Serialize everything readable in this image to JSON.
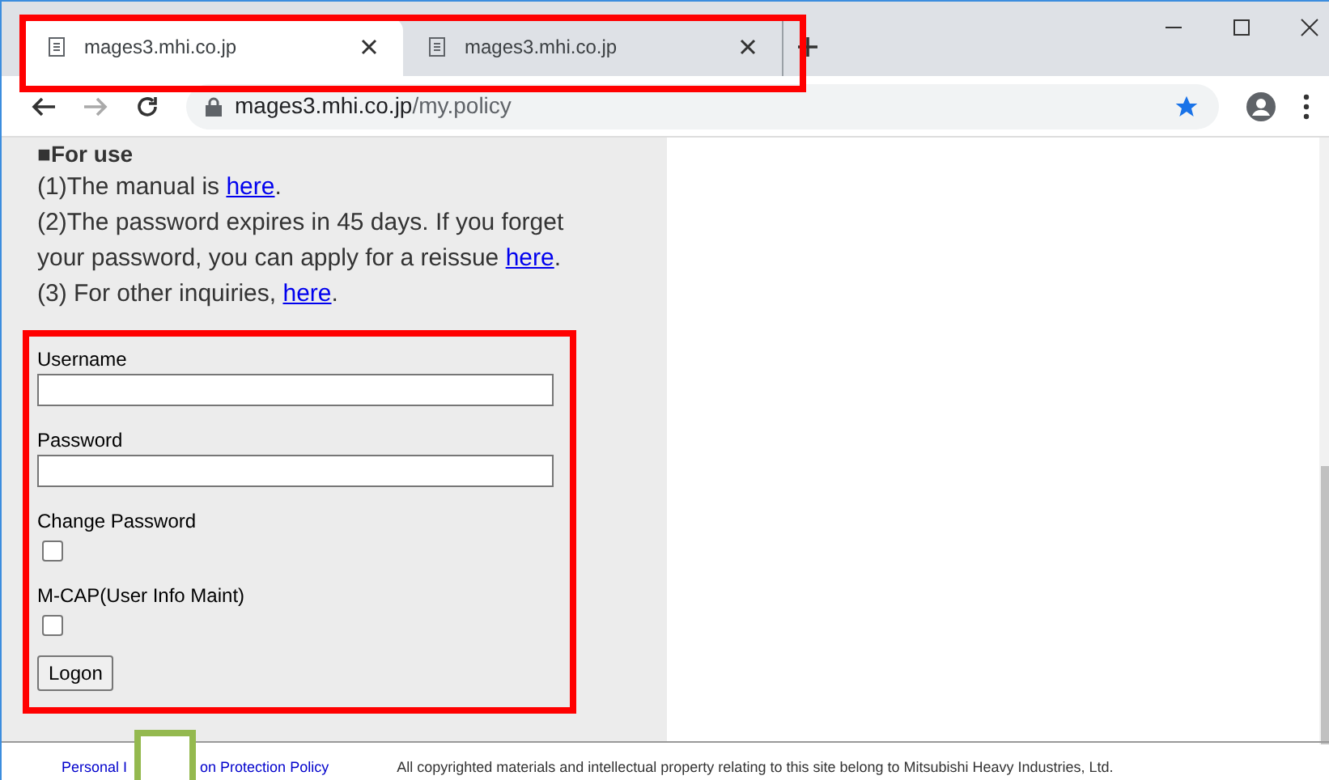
{
  "tabs": [
    {
      "title": "mages3.mhi.co.jp",
      "selected": true
    },
    {
      "title": "mages3.mhi.co.jp",
      "selected": false
    }
  ],
  "address_bar": {
    "domain": "mages3.mhi.co.jp",
    "path": "/my.policy"
  },
  "notice": {
    "heading": "■For use",
    "lines": [
      {
        "text": "(1)The manual is ",
        "link": "here",
        "after": "."
      },
      {
        "text": "(2)The password expires in 45 days. If you forget your password, you can apply for a reissue ",
        "link": "here",
        "after": "."
      },
      {
        "text": "(3) For other inquiries, ",
        "link": "here",
        "after": "."
      }
    ]
  },
  "form": {
    "fields": [
      {
        "kind": "text",
        "label": "Username"
      },
      {
        "kind": "text",
        "label": "Password"
      },
      {
        "kind": "checkbox",
        "label": "Change Password",
        "checked": false
      },
      {
        "kind": "checkbox",
        "label": "M-CAP(User Info Maint)",
        "checked": false
      }
    ],
    "button": "Logon"
  },
  "footer": {
    "privacy_link_before": "Personal I",
    "privacy_link_after": "on Protection Policy",
    "copyright": "All copyrighted materials and intellectual property relating to this site belong to Mitsubishi Heavy Industries, Ltd."
  }
}
